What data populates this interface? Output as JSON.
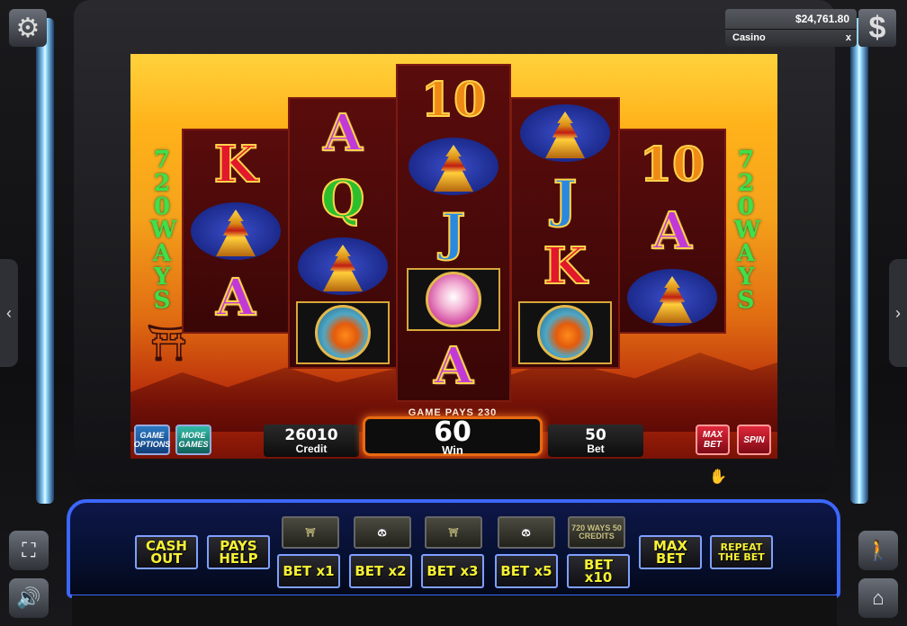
{
  "header": {
    "balance": "$24,761.80",
    "account": "Casino",
    "close": "x"
  },
  "game": {
    "ways_left": [
      "7",
      "2",
      "0",
      "W",
      "A",
      "Y",
      "S"
    ],
    "ways_right": [
      "7",
      "2",
      "0",
      "W",
      "A",
      "Y",
      "S"
    ],
    "reels": [
      [
        "K",
        "temple",
        "A"
      ],
      [
        "A",
        "Q",
        "temple",
        "fish"
      ],
      [
        "10",
        "temple",
        "J",
        "crane",
        "A"
      ],
      [
        "temple",
        "J",
        "K",
        "fish"
      ],
      [
        "10",
        "A",
        "temple"
      ]
    ],
    "game_pays": "GAME PAYS 230",
    "credit": "26010",
    "credit_label": "Credit",
    "win": "60",
    "win_label": "Win",
    "bet": "50",
    "bet_label": "Bet",
    "game_options": "GAME OPTIONS",
    "more_games": "MORE GAMES",
    "max_bet": "MAX BET",
    "spin": "SPIN"
  },
  "deck": {
    "cash_out": "CASH OUT",
    "pays_help": "PAYS HELP",
    "bet_x1": "BET x1",
    "bet_x2": "BET x2",
    "bet_x3": "BET x3",
    "bet_x5": "BET x5",
    "bet_x10": "BET x10",
    "max_bet": "MAX BET",
    "repeat_bet": "REPEAT THE BET",
    "ways_credits": "720 WAYS 50 CREDITS"
  },
  "colors": {
    "accent_blue": "#3c67ff",
    "button_yellow": "#f6f034",
    "win_border": "#e86a12"
  }
}
